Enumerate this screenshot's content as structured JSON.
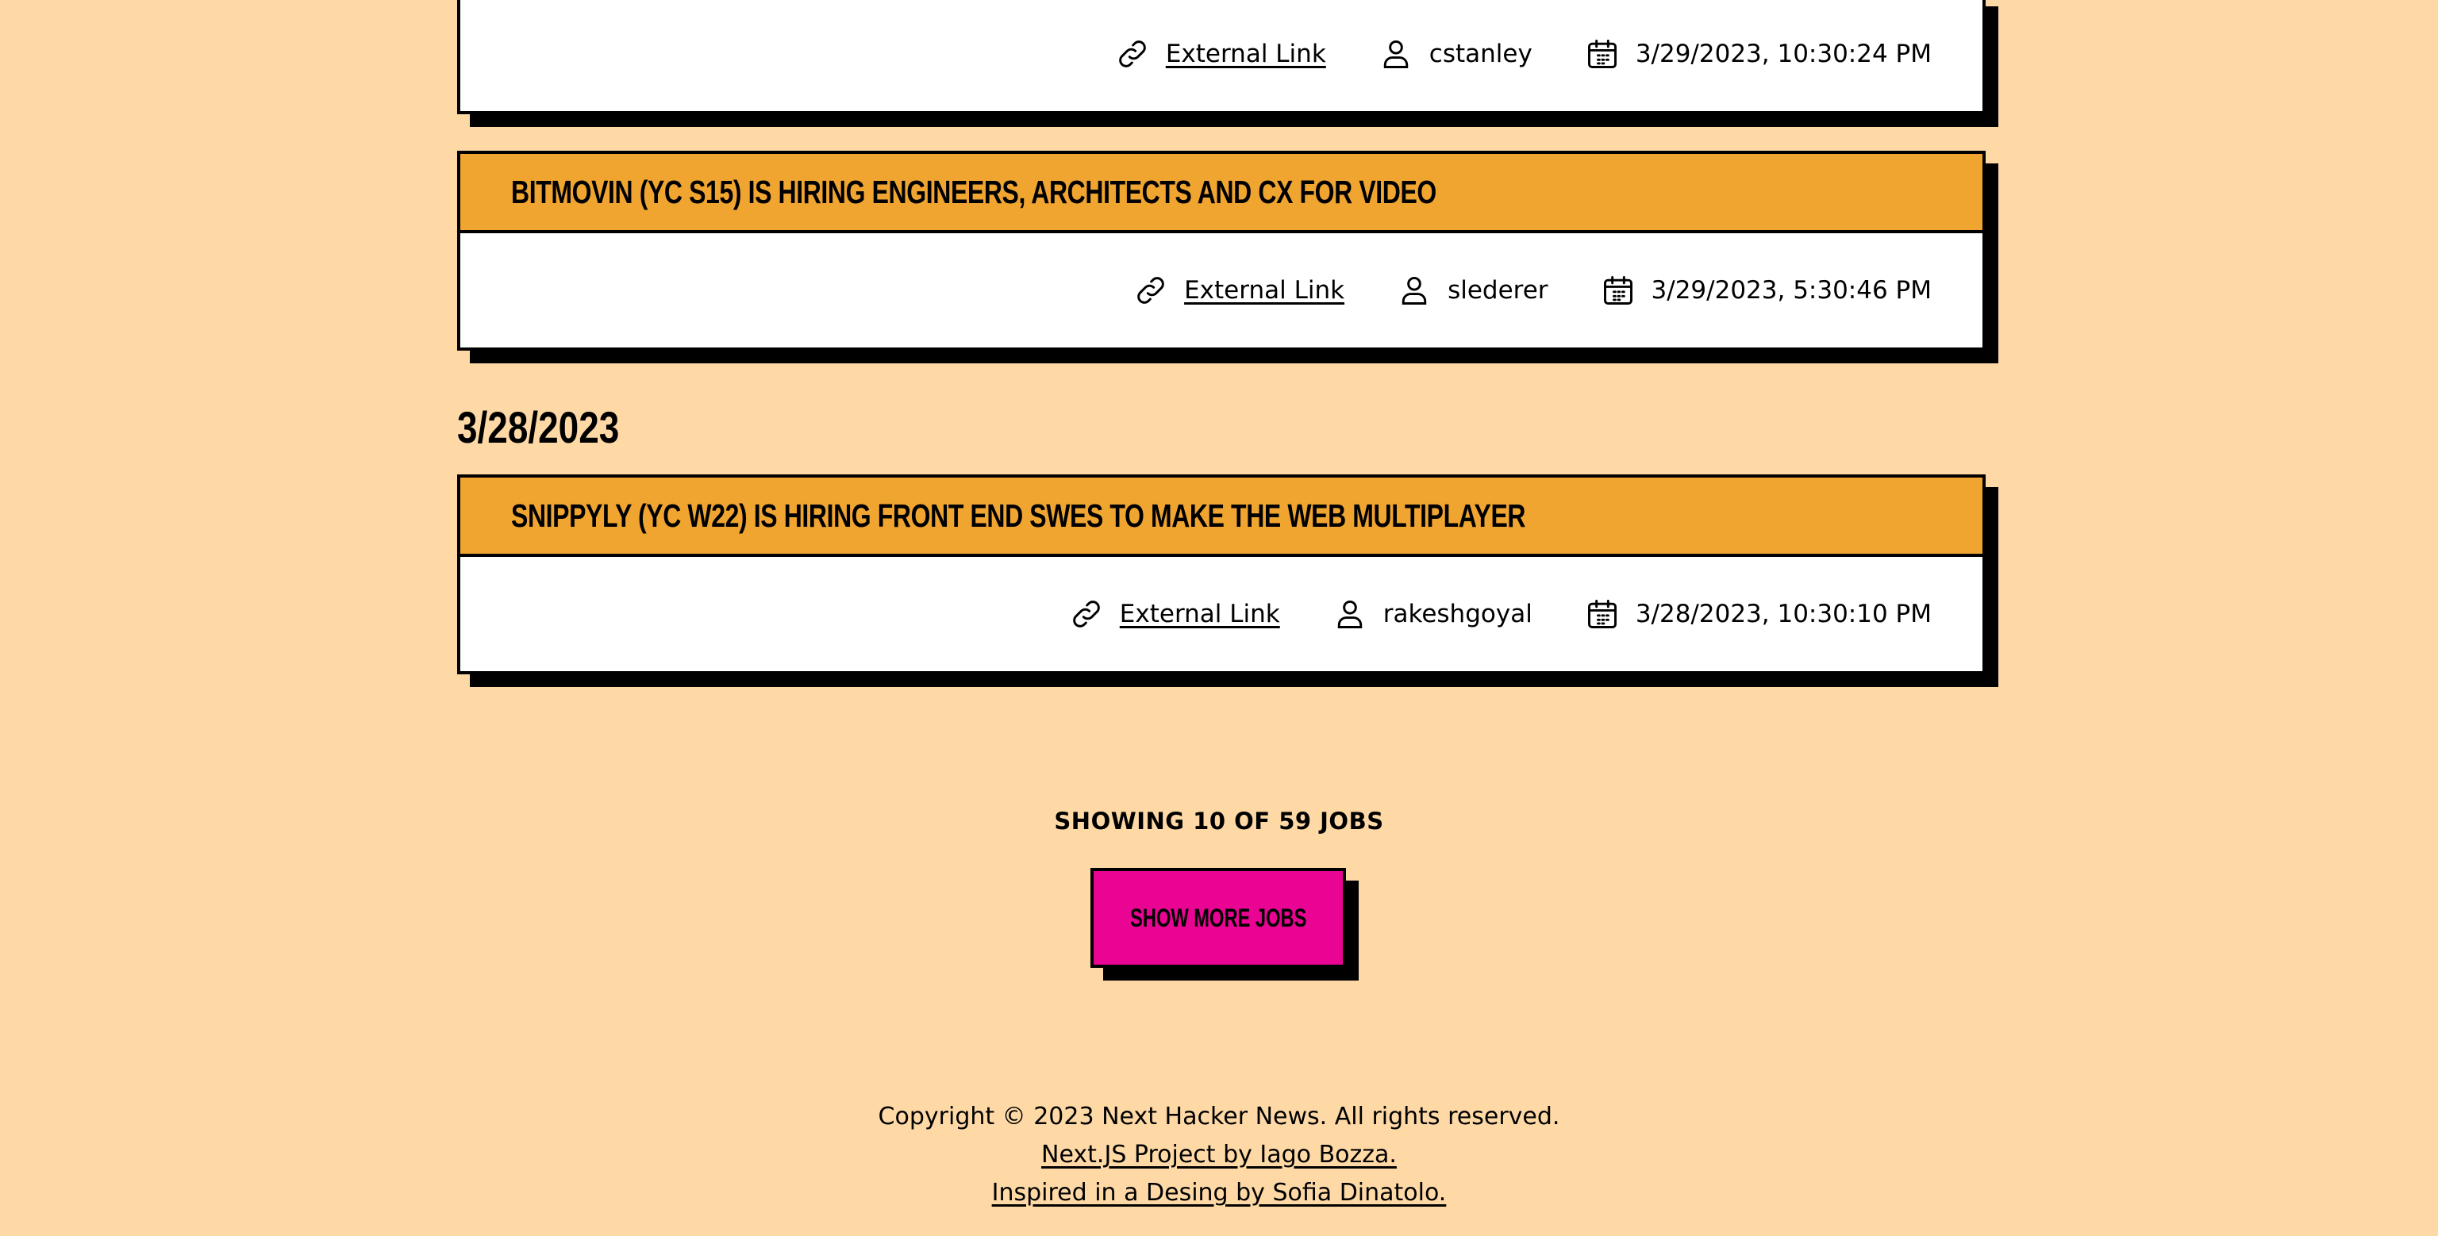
{
  "jobs": [
    {
      "title": "",
      "link_label": "External Link",
      "author": "cstanley",
      "posted": "3/29/2023, 10:30:24 PM"
    },
    {
      "title": "Bitmovin (YC S15) Is Hiring Engineers, Architects and CX for Video",
      "link_label": "External Link",
      "author": "slederer",
      "posted": "3/29/2023, 5:30:46 PM"
    },
    {
      "title": "Snippyly (YC W22) Is Hiring Front End SWEs to Make the Web Multiplayer",
      "link_label": "External Link",
      "author": "rakeshgoyal",
      "posted": "3/28/2023, 10:30:10 PM"
    }
  ],
  "date_group": "3/28/2023",
  "showing_text": "SHOWING 10 OF 59 JOBS",
  "show_more_label": "Show More Jobs",
  "footer": {
    "copyright": "Copyright © 2023 Next Hacker News. All rights reserved.",
    "project_link": "Next.JS Project by Iago Bozza.",
    "design_link": "Inspired in a Desing by Sofia Dinatolo."
  },
  "colors": {
    "background": "#fed9a6",
    "card_header": "#f0a531",
    "button": "#ea0493",
    "border": "#000000"
  },
  "icons": {
    "link": "link-icon",
    "user": "user-icon",
    "calendar": "calendar-icon"
  }
}
